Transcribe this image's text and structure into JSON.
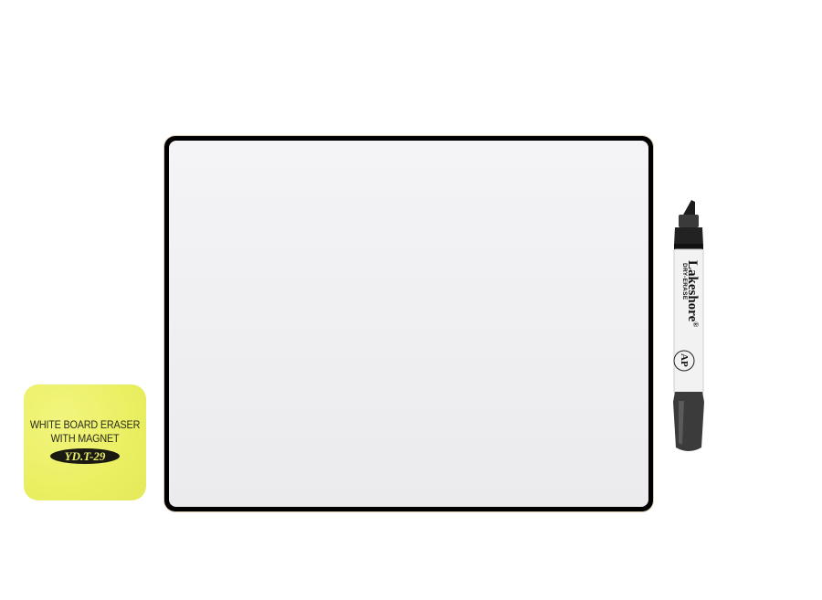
{
  "eraser": {
    "line1": "WHITE BOARD ERASER",
    "line2": "WITH MAGNET",
    "model": "YD.T-29",
    "color": "#ecf16a"
  },
  "marker": {
    "brand": "Lakeshore",
    "brand_mark": "®",
    "subtitle": "DRY-ERASE",
    "seal": "AP",
    "cap_color": "#2a2a2a",
    "body_color": "#f2f2f2"
  },
  "whiteboard": {
    "frame_color": "#000000",
    "surface_color": "#f0f0f2"
  }
}
